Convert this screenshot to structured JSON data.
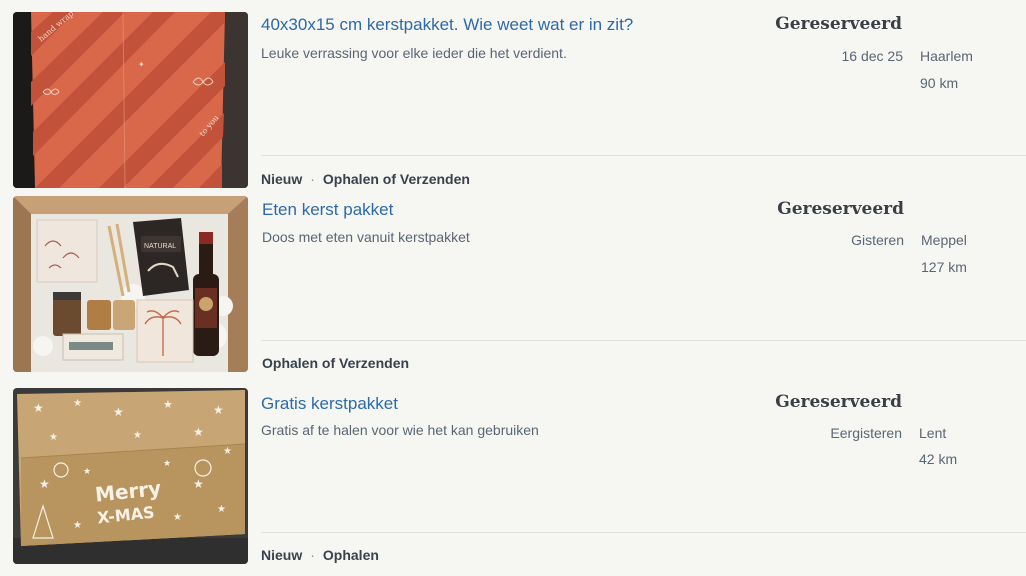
{
  "listings": [
    {
      "title": "40x30x15 cm kerstpakket. Wie weet wat er in zit?",
      "description": "Leuke verrassing voor elke ieder die het verdient.",
      "status": "Gereserveerd",
      "date": "16 dec 25",
      "city": "Haarlem",
      "distance": "90 km",
      "tags": [
        "Nieuw",
        "Ophalen of Verzenden"
      ],
      "image": "orange-striped-gift-box"
    },
    {
      "title": "Eten kerst pakket",
      "description": "Doos met eten vanuit kerstpakket",
      "status": "Gereserveerd",
      "date": "Gisteren",
      "city": "Meppel",
      "distance": "127 km",
      "tags": [
        "Ophalen of Verzenden"
      ],
      "image": "food-package-box"
    },
    {
      "title": "Gratis kerstpakket",
      "description": "Gratis af te halen voor wie het kan gebruiken",
      "status": "Gereserveerd",
      "date": "Eergisteren",
      "city": "Lent",
      "distance": "42 km",
      "tags": [
        "Nieuw",
        "Ophalen"
      ],
      "image": "merry-xmas-gift-box",
      "image_text": [
        "Merry",
        "X-MAS"
      ]
    }
  ],
  "tag_separator": "·",
  "colors": {
    "title": "#2d6aa8",
    "status": "#3a3f45",
    "background": "#f6f6f3"
  }
}
